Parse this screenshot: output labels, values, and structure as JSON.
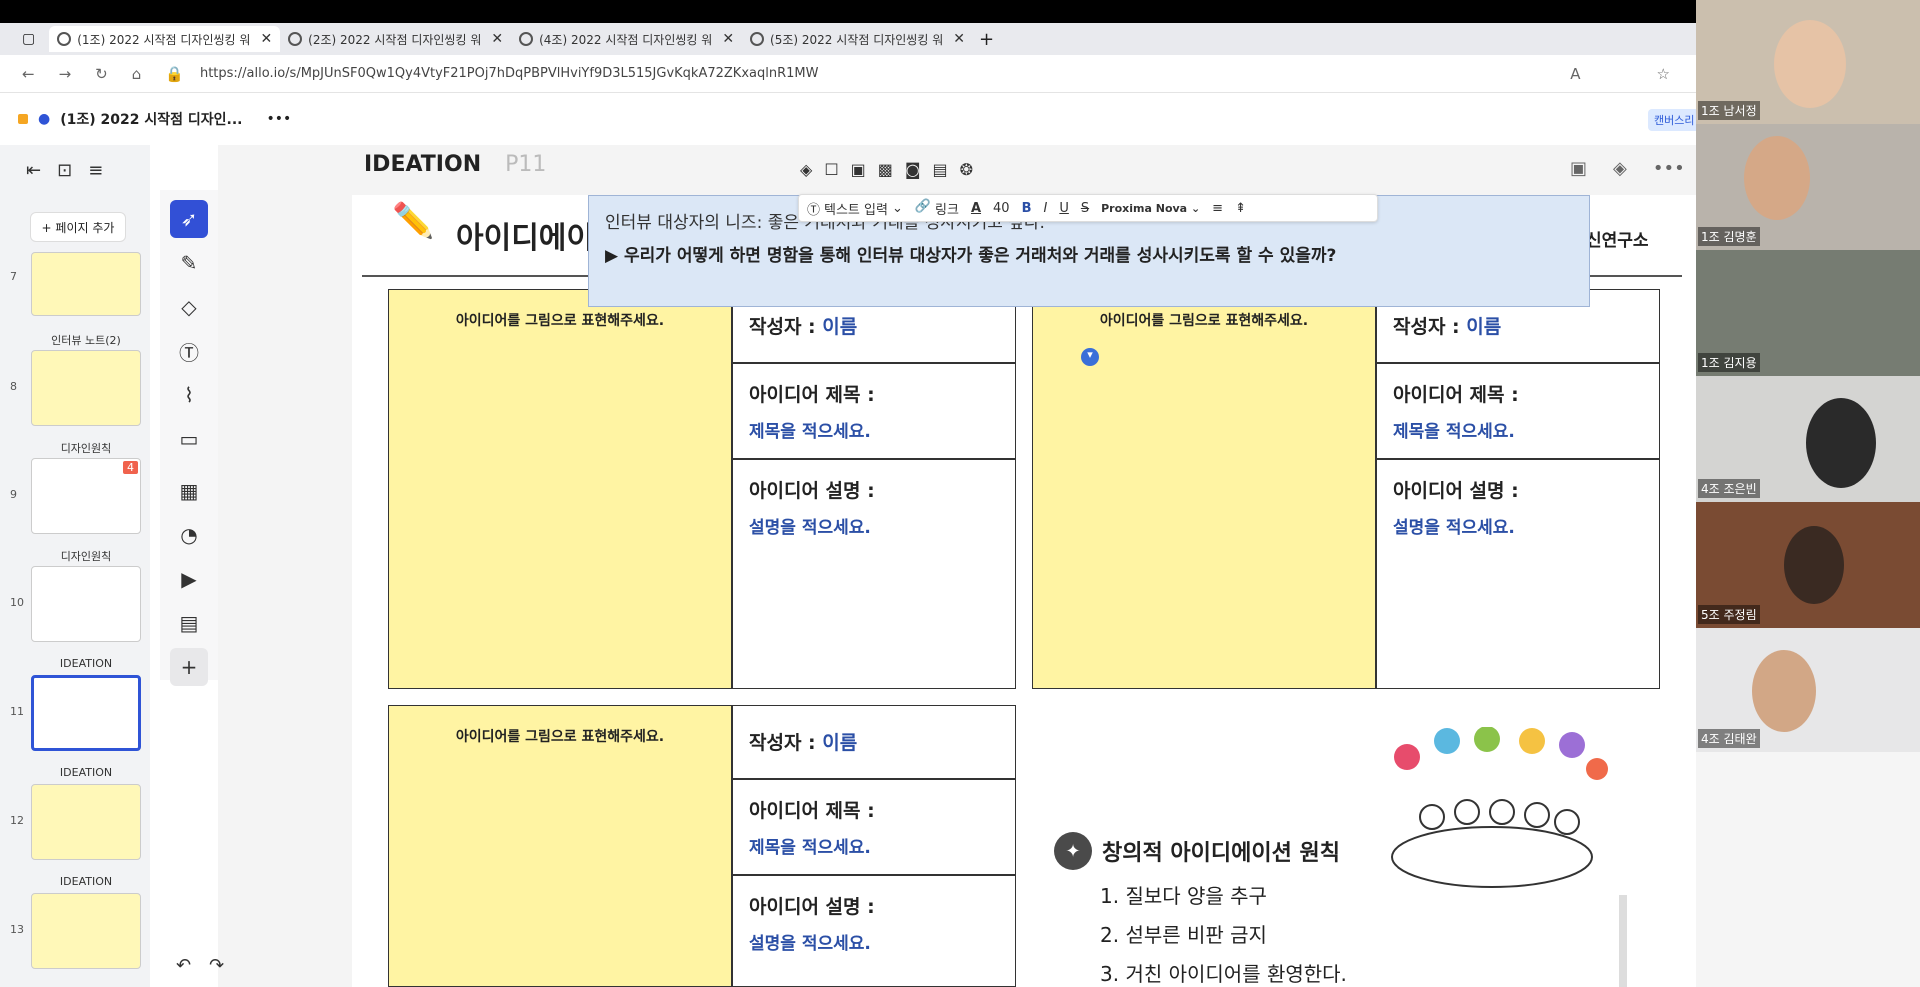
{
  "tabs": [
    {
      "label": "(1조) 2022 시작점 디자인씽킹 워",
      "active": true
    },
    {
      "label": "(2조) 2022 시작점 디자인씽킹 워",
      "active": false
    },
    {
      "label": "(4조) 2022 시작점 디자인씽킹 워",
      "active": false
    },
    {
      "label": "(5조) 2022 시작점 디자인씽킹 워",
      "active": false
    }
  ],
  "browser": {
    "url": "https://allo.io/s/MpJUnSF0Qw1Qy4VtyF21POj7hDqPBPVlHviYf9D3L515JGvKqkA72ZKxaqlnR1MW"
  },
  "app": {
    "title": "(1조) 2022 시작점 디자인...",
    "more": "•••",
    "right_badge": "캔버스리"
  },
  "sidebar": {
    "add_page": "+ 페이지 추가",
    "pages": [
      {
        "num": "7",
        "label": ""
      },
      {
        "num": "8",
        "label": "인터뷰 노트(2)"
      },
      {
        "num": "9",
        "label": "디자인원칙",
        "badge": "4"
      },
      {
        "num": "10",
        "label": "디자인원칙"
      },
      {
        "num": "11",
        "label": "IDEATION"
      },
      {
        "num": "12",
        "label": "IDEATION"
      },
      {
        "num": "13",
        "label": "IDEATION"
      }
    ]
  },
  "page": {
    "title": "IDEATION",
    "code": "P11"
  },
  "slide": {
    "title": "아이디에이",
    "logo": "신연구소",
    "draw_hint": "아이디어를 그림으로 표현해주세요.",
    "author_label": "작성자 :",
    "author_value": "이름",
    "idea_title_label": "아이디어 제목 :",
    "idea_title_value": "제목을 적으세요.",
    "idea_desc_label": "아이디어 설명 :",
    "idea_desc_value": "설명을 적으세요."
  },
  "popup": {
    "line1": "인터뷰 대상자의 니즈: 좋은 거래처와 거래를 성사시키고 싶다.",
    "line2": "▶ 우리가 어떻게 하면 명함을 통해 인터뷰 대상자가 좋은 거래처와 거래를 성사시키도록 할 수 있을까?"
  },
  "format_bar": {
    "text_input": "텍스트 입력",
    "link": "링크",
    "font_size": "40",
    "font": "Proxima Nova"
  },
  "principles": {
    "title": "창의적 아이디에이션 원칙",
    "items": [
      "1. 질보다 양을 추구",
      "2. 섣부른 비판 금지",
      "3. 거친 아이디어를 환영한다."
    ]
  },
  "participants": [
    "1조 남서정",
    "1조 김명훈",
    "1조 김지용",
    "4조 조은빈",
    "5조 주정림",
    "4조 김태완"
  ]
}
